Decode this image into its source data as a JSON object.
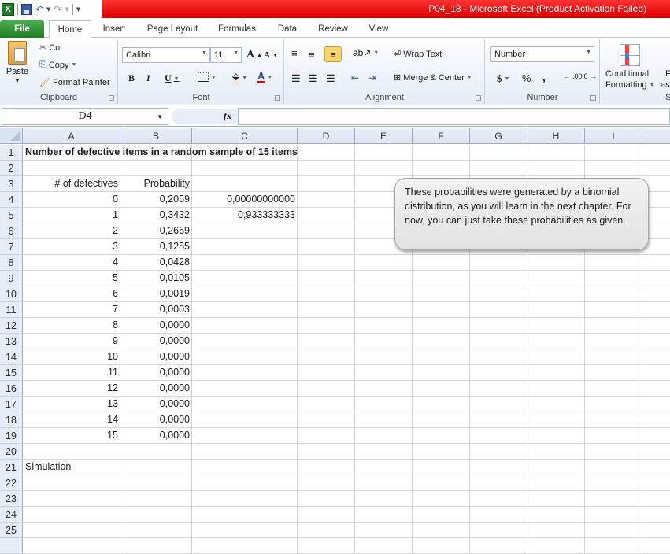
{
  "window": {
    "title": "P04_18  -  Microsoft Excel (Product Activation Failed)"
  },
  "quick_access": {
    "icons": [
      "excel-icon",
      "save-icon",
      "undo-icon",
      "redo-icon",
      "customize-icon"
    ]
  },
  "tabs": [
    {
      "label": "File"
    },
    {
      "label": "Home"
    },
    {
      "label": "Insert"
    },
    {
      "label": "Page Layout"
    },
    {
      "label": "Formulas"
    },
    {
      "label": "Data"
    },
    {
      "label": "Review"
    },
    {
      "label": "View"
    }
  ],
  "ribbon": {
    "clipboard": {
      "label": "Clipboard",
      "paste": "Paste",
      "cut": "Cut",
      "copy": "Copy",
      "format_painter": "Format Painter"
    },
    "font": {
      "label": "Font",
      "font_name": "Calibri",
      "font_size": "11",
      "bold": "B",
      "italic": "I",
      "underline": "U",
      "grow": "A",
      "shrink": "A",
      "color_a": "A"
    },
    "alignment": {
      "label": "Alignment",
      "wrap_text": "Wrap Text",
      "merge_center": "Merge & Center"
    },
    "number": {
      "label": "Number",
      "format": "Number",
      "currency": "$",
      "percent": "%",
      "comma": ",",
      "inc_decimal": ".00",
      "dec_decimal": ".0"
    },
    "styles": {
      "label": "Sty",
      "conditional_formatting_1": "Conditional",
      "conditional_formatting_2": "Formatting",
      "format_as_1": "F",
      "format_as_2": "as"
    }
  },
  "formula_bar": {
    "name_box": "D4",
    "fx": "fx",
    "formula": ""
  },
  "columns": [
    "A",
    "B",
    "C",
    "D",
    "E",
    "F",
    "G",
    "H",
    "I"
  ],
  "rows": [
    "1",
    "2",
    "3",
    "4",
    "5",
    "6",
    "7",
    "8",
    "9",
    "10",
    "11",
    "12",
    "13",
    "14",
    "15",
    "16",
    "17",
    "18",
    "19",
    "20",
    "21",
    "22",
    "23",
    "24",
    "25"
  ],
  "cells": {
    "A1": "Number of defective items in a random sample of 15 items",
    "A3": "# of defectives",
    "B3": "Probability",
    "C4": "0,00000000000",
    "C5": "0,933333333",
    "A21": "Simulation"
  },
  "table": [
    {
      "defectives": "0",
      "probability": "0,2059"
    },
    {
      "defectives": "1",
      "probability": "0,3432"
    },
    {
      "defectives": "2",
      "probability": "0,2669"
    },
    {
      "defectives": "3",
      "probability": "0,1285"
    },
    {
      "defectives": "4",
      "probability": "0,0428"
    },
    {
      "defectives": "5",
      "probability": "0,0105"
    },
    {
      "defectives": "6",
      "probability": "0,0019"
    },
    {
      "defectives": "7",
      "probability": "0,0003"
    },
    {
      "defectives": "8",
      "probability": "0,0000"
    },
    {
      "defectives": "9",
      "probability": "0,0000"
    },
    {
      "defectives": "10",
      "probability": "0,0000"
    },
    {
      "defectives": "11",
      "probability": "0,0000"
    },
    {
      "defectives": "12",
      "probability": "0,0000"
    },
    {
      "defectives": "13",
      "probability": "0,0000"
    },
    {
      "defectives": "14",
      "probability": "0,0000"
    },
    {
      "defectives": "15",
      "probability": "0,0000"
    }
  ],
  "callout": {
    "text": "These probabilities were generated by a binomial distribution, as you will learn in the next chapter. For now, you can just take these probabilities as given."
  },
  "colors": {
    "title_bar": "#e00000",
    "file_tab": "#2a8a2e",
    "header_bg": "#dae4f2",
    "align_active": "#fcd667",
    "font_color_bar": "#e00000"
  }
}
